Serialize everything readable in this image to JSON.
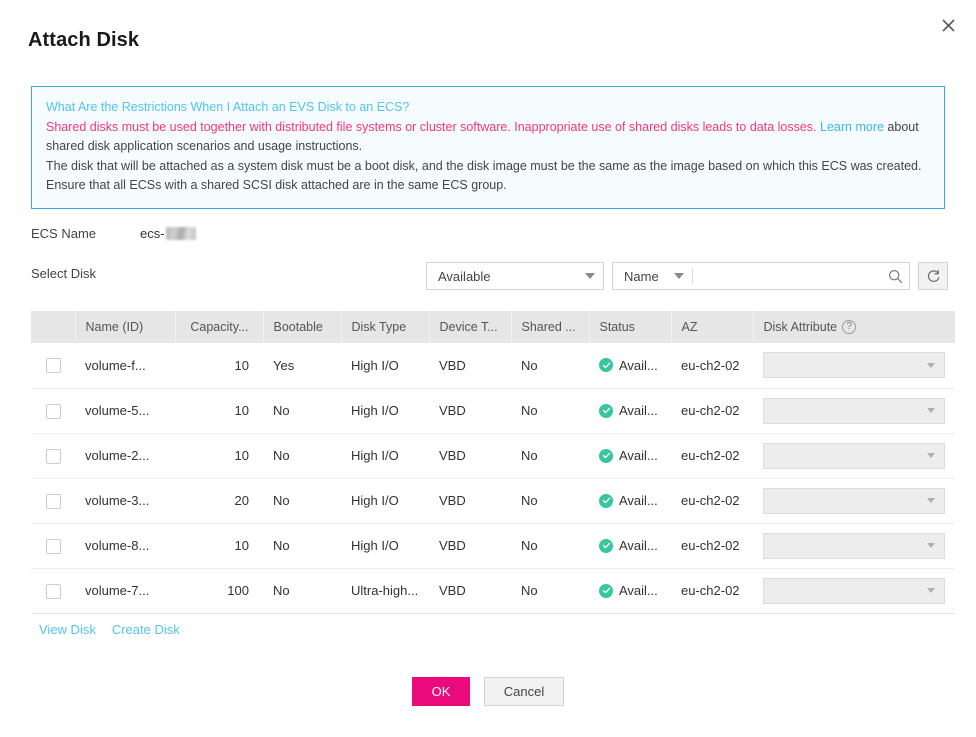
{
  "dialog": {
    "title": "Attach Disk",
    "close_icon": "close-icon"
  },
  "notice": {
    "link_title": "What Are the Restrictions When I Attach an EVS Disk to an ECS?",
    "warn_text": "Shared disks must be used together with distributed file systems or cluster software. Inappropriate use of shared disks leads to data losses.",
    "learn_more": "Learn more",
    "warn_tail": " about shared disk application scenarios and usage instructions.",
    "line3": "The disk that will be attached as a system disk must be a boot disk, and the disk image must be the same as the image based on which this ECS was created.",
    "line4": "Ensure that all ECSs with a shared SCSI disk attached are in the same ECS group.",
    "border_color": "#3aa5e0",
    "background_color": "#f6fbfe",
    "link_color": "#52c5f0",
    "warn_color": "#f3387f"
  },
  "form": {
    "ecs_name_label": "ECS Name",
    "ecs_name_value": "ecs-",
    "select_disk_label": "Select Disk"
  },
  "toolbar": {
    "status_filter": "Available",
    "search_type": "Name",
    "search_placeholder": "",
    "search_value": "",
    "search_icon": "search-icon",
    "refresh_icon": "refresh-icon"
  },
  "table": {
    "columns": [
      {
        "key": "check",
        "label": ""
      },
      {
        "key": "name",
        "label": "Name (ID)"
      },
      {
        "key": "capacity",
        "label": "Capacity..."
      },
      {
        "key": "bootable",
        "label": "Bootable"
      },
      {
        "key": "disk_type",
        "label": "Disk Type"
      },
      {
        "key": "device_type",
        "label": "Device T..."
      },
      {
        "key": "shared",
        "label": "Shared ..."
      },
      {
        "key": "status",
        "label": "Status"
      },
      {
        "key": "az",
        "label": "AZ"
      },
      {
        "key": "attribute",
        "label": "Disk Attribute"
      }
    ],
    "help_icon_label": "?",
    "rows": [
      {
        "name": "volume-f...",
        "capacity": "10",
        "bootable": "Yes",
        "disk_type": "High I/O",
        "device_type": "VBD",
        "shared": "No",
        "status": "Avail...",
        "az": "eu-ch2-02",
        "attribute": ""
      },
      {
        "name": "volume-5...",
        "capacity": "10",
        "bootable": "No",
        "disk_type": "High I/O",
        "device_type": "VBD",
        "shared": "No",
        "status": "Avail...",
        "az": "eu-ch2-02",
        "attribute": ""
      },
      {
        "name": "volume-2...",
        "capacity": "10",
        "bootable": "No",
        "disk_type": "High I/O",
        "device_type": "VBD",
        "shared": "No",
        "status": "Avail...",
        "az": "eu-ch2-02",
        "attribute": ""
      },
      {
        "name": "volume-3...",
        "capacity": "20",
        "bootable": "No",
        "disk_type": "High I/O",
        "device_type": "VBD",
        "shared": "No",
        "status": "Avail...",
        "az": "eu-ch2-02",
        "attribute": ""
      },
      {
        "name": "volume-8...",
        "capacity": "10",
        "bootable": "No",
        "disk_type": "High I/O",
        "device_type": "VBD",
        "shared": "No",
        "status": "Avail...",
        "az": "eu-ch2-02",
        "attribute": ""
      },
      {
        "name": "volume-7...",
        "capacity": "100",
        "bootable": "No",
        "disk_type": "Ultra-high...",
        "device_type": "VBD",
        "shared": "No",
        "status": "Avail...",
        "az": "eu-ch2-02",
        "attribute": ""
      }
    ],
    "status_color": "#38c6a0",
    "header_background": "#e6e6e6"
  },
  "table_links": {
    "view_disk": "View Disk",
    "create_disk": "Create Disk",
    "color": "#52c5f0"
  },
  "actions": {
    "ok": "OK",
    "cancel": "Cancel",
    "primary_color": "#eb0a7d"
  }
}
